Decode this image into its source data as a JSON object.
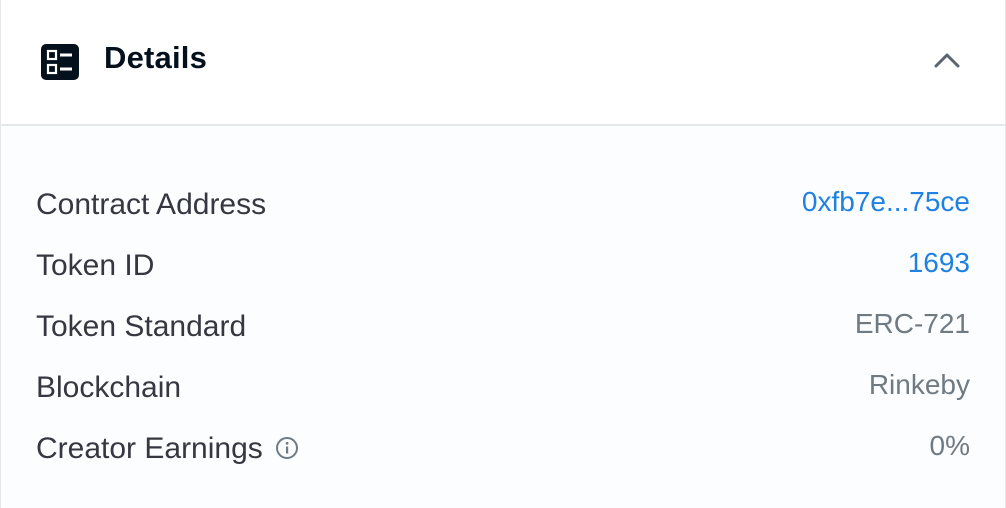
{
  "header": {
    "title": "Details",
    "icon": "details-grid-icon",
    "toggle_icon": "chevron-up-icon"
  },
  "details": {
    "rows": [
      {
        "label": "Contract Address",
        "value": "0xfb7e...75ce",
        "is_link": true
      },
      {
        "label": "Token ID",
        "value": "1693",
        "is_link": true
      },
      {
        "label": "Token Standard",
        "value": "ERC-721",
        "is_link": false
      },
      {
        "label": "Blockchain",
        "value": "Rinkeby",
        "is_link": false
      },
      {
        "label": "Creator Earnings",
        "value": "0%",
        "is_link": false,
        "info_icon": "info-circle-icon"
      }
    ]
  },
  "colors": {
    "title": "#04111d",
    "label": "#353840",
    "link": "#2081e2",
    "muted": "#707a83",
    "divider": "#e5e8eb",
    "body_bg": "#fbfdff"
  }
}
